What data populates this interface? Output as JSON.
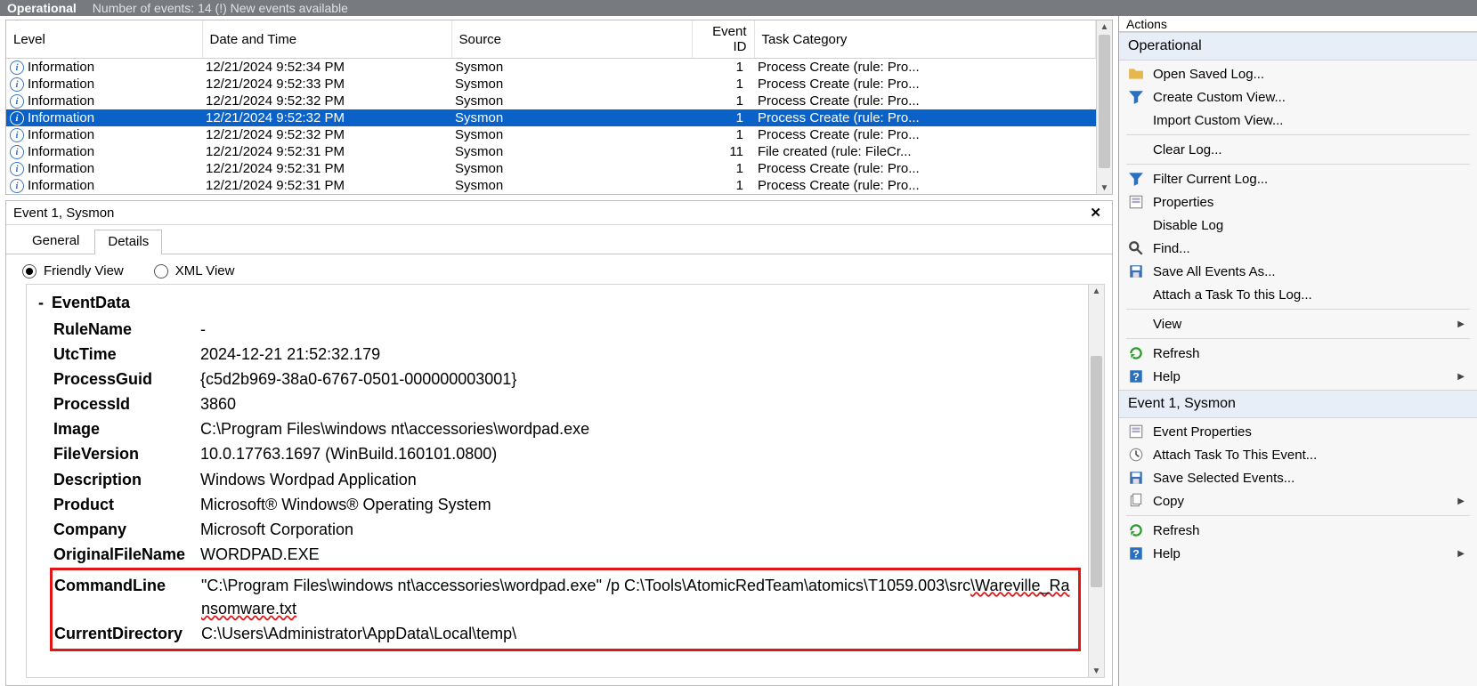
{
  "header": {
    "title": "Operational",
    "subtitle": "Number of events: 14 (!) New events available"
  },
  "columns": {
    "level": "Level",
    "date": "Date and Time",
    "source": "Source",
    "eventid": "Event ID",
    "task": "Task Category"
  },
  "rows": [
    {
      "level": "Information",
      "date": "12/21/2024 9:52:34 PM",
      "source": "Sysmon",
      "eventid": "1",
      "task": "Process Create (rule: Pro...",
      "selected": false
    },
    {
      "level": "Information",
      "date": "12/21/2024 9:52:33 PM",
      "source": "Sysmon",
      "eventid": "1",
      "task": "Process Create (rule: Pro...",
      "selected": false
    },
    {
      "level": "Information",
      "date": "12/21/2024 9:52:32 PM",
      "source": "Sysmon",
      "eventid": "1",
      "task": "Process Create (rule: Pro...",
      "selected": false
    },
    {
      "level": "Information",
      "date": "12/21/2024 9:52:32 PM",
      "source": "Sysmon",
      "eventid": "1",
      "task": "Process Create (rule: Pro...",
      "selected": true
    },
    {
      "level": "Information",
      "date": "12/21/2024 9:52:32 PM",
      "source": "Sysmon",
      "eventid": "1",
      "task": "Process Create (rule: Pro...",
      "selected": false
    },
    {
      "level": "Information",
      "date": "12/21/2024 9:52:31 PM",
      "source": "Sysmon",
      "eventid": "11",
      "task": "File created (rule: FileCr...",
      "selected": false
    },
    {
      "level": "Information",
      "date": "12/21/2024 9:52:31 PM",
      "source": "Sysmon",
      "eventid": "1",
      "task": "Process Create (rule: Pro...",
      "selected": false
    },
    {
      "level": "Information",
      "date": "12/21/2024 9:52:31 PM",
      "source": "Sysmon",
      "eventid": "1",
      "task": "Process Create (rule: Pro...",
      "selected": false
    }
  ],
  "detailHeader": "Event 1, Sysmon",
  "tabs": {
    "general": "General",
    "details": "Details"
  },
  "views": {
    "friendly": "Friendly View",
    "xml": "XML View"
  },
  "eventDataTitle": "EventData",
  "kv": {
    "RuleName": "-",
    "UtcTime": "2024-12-21 21:52:32.179",
    "ProcessGuid": "{c5d2b969-38a0-6767-0501-000000003001}",
    "ProcessId": "3860",
    "Image": "C:\\Program Files\\windows nt\\accessories\\wordpad.exe",
    "FileVersion": "10.0.17763.1697 (WinBuild.160101.0800)",
    "Description": "Windows Wordpad Application",
    "Product": "Microsoft® Windows® Operating System",
    "Company": "Microsoft Corporation",
    "OriginalFileName": "WORDPAD.EXE",
    "CommandLine_pre": "\"C:\\Program Files\\windows nt\\accessories\\wordpad.exe\" /p C:\\Tools\\AtomicRedTeam\\atomics\\T1059.003\\src",
    "CommandLine_hl": "\\Wareville_Ransomware.txt",
    "CurrentDirectory": "C:\\Users\\Administrator\\AppData\\Local\\temp\\"
  },
  "kvLabels": {
    "RuleName": "RuleName",
    "UtcTime": "UtcTime",
    "ProcessGuid": "ProcessGuid",
    "ProcessId": "ProcessId",
    "Image": "Image",
    "FileVersion": "FileVersion",
    "Description": "Description",
    "Product": "Product",
    "Company": "Company",
    "OriginalFileName": "OriginalFileName",
    "CommandLine": "CommandLine",
    "CurrentDirectory": "CurrentDirectory"
  },
  "actions": {
    "panelTitle": "Actions",
    "section1": "Operational",
    "section2": "Event 1, Sysmon",
    "items1": [
      "Open Saved Log...",
      "Create Custom View...",
      "Import Custom View...",
      "Clear Log...",
      "Filter Current Log...",
      "Properties",
      "Disable Log",
      "Find...",
      "Save All Events As...",
      "Attach a Task To this Log...",
      "View",
      "Refresh",
      "Help"
    ],
    "items2": [
      "Event Properties",
      "Attach Task To This Event...",
      "Save Selected Events...",
      "Copy",
      "Refresh",
      "Help"
    ]
  }
}
